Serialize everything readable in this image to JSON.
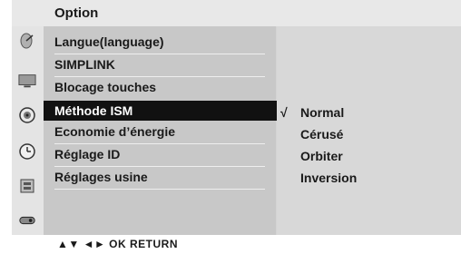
{
  "header": {
    "title": "Option"
  },
  "menu": {
    "items": [
      {
        "label": "Langue(language)"
      },
      {
        "label": "SIMPLINK"
      },
      {
        "label": "Blocage touches"
      },
      {
        "label": "Méthode ISM",
        "selected": true
      },
      {
        "label": "Economie d’énergie"
      },
      {
        "label": "Réglage ID"
      },
      {
        "label": "Réglages usine"
      }
    ],
    "selected_arrow": "►"
  },
  "submenu": {
    "check_mark": "√",
    "options": [
      {
        "label": "Normal",
        "checked": true
      },
      {
        "label": "Cérusé"
      },
      {
        "label": "Orbiter"
      },
      {
        "label": "Inversion"
      }
    ]
  },
  "icons": [
    "satellite-dish-icon",
    "tv-screen-icon",
    "speaker-icon",
    "clock-icon",
    "lock-box-icon",
    "remote-icon"
  ],
  "footer": {
    "hint": "▲▼ ◄► OK RETURN"
  },
  "colors": {
    "selection": "#111111",
    "panel": "#c8c8c8",
    "submenu": "#d8d8d8"
  }
}
